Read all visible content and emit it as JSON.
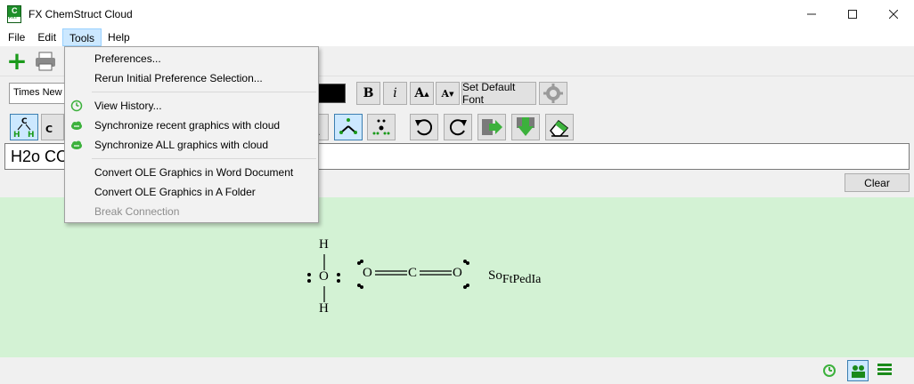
{
  "window": {
    "title": "FX ChemStruct Cloud",
    "app_icon_glyph": "C",
    "app_icon_tag": "FXT"
  },
  "menu": {
    "items": [
      "File",
      "Edit",
      "Tools",
      "Help"
    ]
  },
  "tools_menu": {
    "items": [
      {
        "label": "Preferences...",
        "icon": ""
      },
      {
        "label": "Rerun Initial Preference Selection...",
        "icon": ""
      },
      {
        "label": "View History...",
        "icon": "history-icon"
      },
      {
        "label": "Synchronize recent graphics with cloud",
        "icon": "cloud-sync-icon"
      },
      {
        "label": "Synchronize ALL graphics with cloud",
        "icon": "cloud-sync-icon"
      },
      {
        "label": "Convert OLE Graphics in Word Document",
        "icon": ""
      },
      {
        "label": "Convert OLE Graphics in A Folder",
        "icon": ""
      },
      {
        "label": "Break Connection",
        "icon": "",
        "disabled": true
      }
    ]
  },
  "font_toolbar": {
    "font_name": "Times New Roman",
    "bold_label": "B",
    "italic_label": "i",
    "grow_label": "A",
    "shrink_label": "A",
    "default_font_label": "Set Default Font"
  },
  "formula_input": {
    "value": "H2o CO2"
  },
  "clear_label": "Clear",
  "canvas": {
    "water": {
      "top": "H",
      "center": "O",
      "bottom": "H"
    },
    "co2": {
      "left": "O",
      "center": "C",
      "right": "O"
    },
    "watermark_prefix": "So",
    "watermark_sub": "FtPedIa"
  },
  "colors": {
    "canvas_bg": "#d3f2d4",
    "menu_highlight": "#cce8ff",
    "accent_green": "#1a9a1a"
  }
}
